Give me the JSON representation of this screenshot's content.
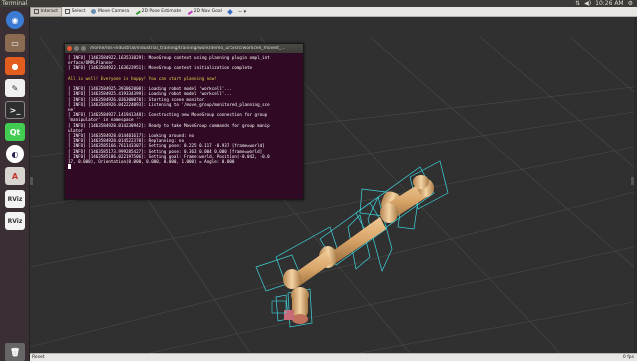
{
  "top_panel": {
    "app_title": "Terminal",
    "clock": "10:26 AM"
  },
  "launcher": {
    "items": [
      {
        "icon": "ubuntu-dash-icon",
        "label": ""
      },
      {
        "icon": "file-manager-icon",
        "label": ""
      },
      {
        "icon": "firefox-icon",
        "label": ""
      },
      {
        "icon": "text-editor-icon",
        "label": ""
      },
      {
        "icon": "terminal-icon",
        "label": ""
      },
      {
        "icon": "qt-creator-icon",
        "label": "Qt"
      },
      {
        "icon": "eclipse-icon",
        "label": ""
      },
      {
        "icon": "software-center-icon",
        "label": ""
      },
      {
        "icon": "rviz-icon",
        "label": "RViz"
      },
      {
        "icon": "rviz-icon",
        "label": "RViz"
      },
      {
        "icon": "trash-icon",
        "label": ""
      }
    ]
  },
  "toolbar": {
    "tools": [
      {
        "icon": "interact-icon",
        "label": "Interact",
        "active": true
      },
      {
        "icon": "select-icon",
        "label": "Select",
        "active": false
      },
      {
        "icon": "move-camera-icon",
        "label": "Move Camera",
        "active": false
      },
      {
        "icon": "pose-estimate-icon",
        "label": "2D Pose Estimate",
        "active": false
      },
      {
        "icon": "nav-goal-icon",
        "label": "2D Nav Goal",
        "active": false
      },
      {
        "icon": "publish-point-icon",
        "label": "",
        "active": false
      },
      {
        "icon": "more-tools-icon",
        "label": "",
        "active": false
      }
    ]
  },
  "terminal": {
    "title": "/home/ros-industrial/industrial_training/training/work/demo_ur5/src/workcell_moveit_...",
    "lines": [
      {
        "text": "[ INFO] [1463584922.163531029]: MoveGroup context using planning plugin ompl_int",
        "warn": false
      },
      {
        "text": "erface/OMPLPlanner",
        "warn": false
      },
      {
        "text": "[ INFO] [1463584922.163623951]: MoveGroup context initialization complete",
        "warn": false
      },
      {
        "text": "",
        "warn": false
      },
      {
        "text": "All is well! Everyone is happy! You can start planning now!",
        "warn": true
      },
      {
        "text": "",
        "warn": false
      },
      {
        "text": "[ INFO] [1463584925.393062000]: Loading robot model 'workcell'...",
        "warn": false
      },
      {
        "text": "[ INFO] [1463584925.419334399]: Loading robot model 'workcell'...",
        "warn": false
      },
      {
        "text": "[ INFO] [1463584926.036300070]: Starting scene monitor",
        "warn": false
      },
      {
        "text": "[ INFO] [1463584926.042224093]: Listening to '/move_group/monitored_planning_sce",
        "warn": false
      },
      {
        "text": "ne'",
        "warn": false
      },
      {
        "text": "[ INFO] [1463584927.141941348]: Constructing new MoveGroup connection for group",
        "warn": false
      },
      {
        "text": "'manipulator' in namespace ''",
        "warn": false
      },
      {
        "text": "[ INFO] [1463584928.014230942]: Ready to take MoveGroup commands for group manip",
        "warn": false
      },
      {
        "text": "ulator",
        "warn": false
      },
      {
        "text": "[ INFO] [1463584928.014401617]: Looking around: no",
        "warn": false
      },
      {
        "text": "[ INFO] [1463584928.014522370]: Replanning: no",
        "warn": false
      },
      {
        "text": "[ INFO] [1463585166.761143307]: Setting pose: 0.225 0.117 -0.937 [frame=world]",
        "warn": false
      },
      {
        "text": "[ INFO] [1463585173.999285427]: Setting pose: 0.363 0.004 0.000 [frame=world]",
        "warn": false
      },
      {
        "text": "[ INFO] [1463585186.022197506]: Setting goal: Frame:world, Position(-0.042, -0.0",
        "warn": false
      },
      {
        "text": "17, 0.000), Orientation(0.000, 0.000, 0.000, 1.000) = Angle: 0.000",
        "warn": false
      }
    ]
  },
  "statusbar": {
    "reset_label": "Reset",
    "fps": "0 fps"
  }
}
